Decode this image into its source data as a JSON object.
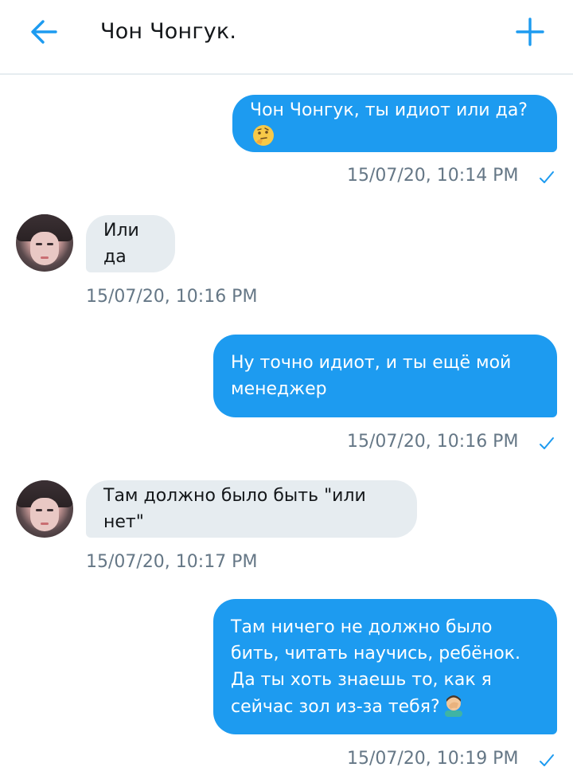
{
  "header": {
    "title": "Чон Чонгук.",
    "back_icon": "arrow-left-icon",
    "new_icon": "plus-icon",
    "accent": "#1d9bf0"
  },
  "messages": [
    {
      "direction": "outgoing",
      "text": "Чон Чонгук, ты идиот или да?",
      "emoji": "thinking-face-emoji",
      "timestamp": "15/07/20, 10:14 PM",
      "read": true
    },
    {
      "direction": "incoming",
      "text": "Или да",
      "timestamp": "15/07/20, 10:16 PM"
    },
    {
      "direction": "outgoing",
      "text": "Ну точно идиот, и ты ещё мой менеджер",
      "timestamp": "15/07/20, 10:16 PM",
      "read": true
    },
    {
      "direction": "incoming",
      "text": "Там должно было быть \"или нет\"",
      "timestamp": "15/07/20, 10:17 PM"
    },
    {
      "direction": "outgoing",
      "text": "Там ничего не должно было бить, читать научись, ребёнок. Да ты хоть знаешь то, как я сейчас зол из-за тебя?",
      "emoji": "facepalm-emoji",
      "timestamp": "15/07/20, 10:19 PM",
      "read": true
    }
  ],
  "colors": {
    "outgoing_bubble": "#1d9bf0",
    "incoming_bubble": "#e6ecf0",
    "timestamp": "#657786"
  }
}
